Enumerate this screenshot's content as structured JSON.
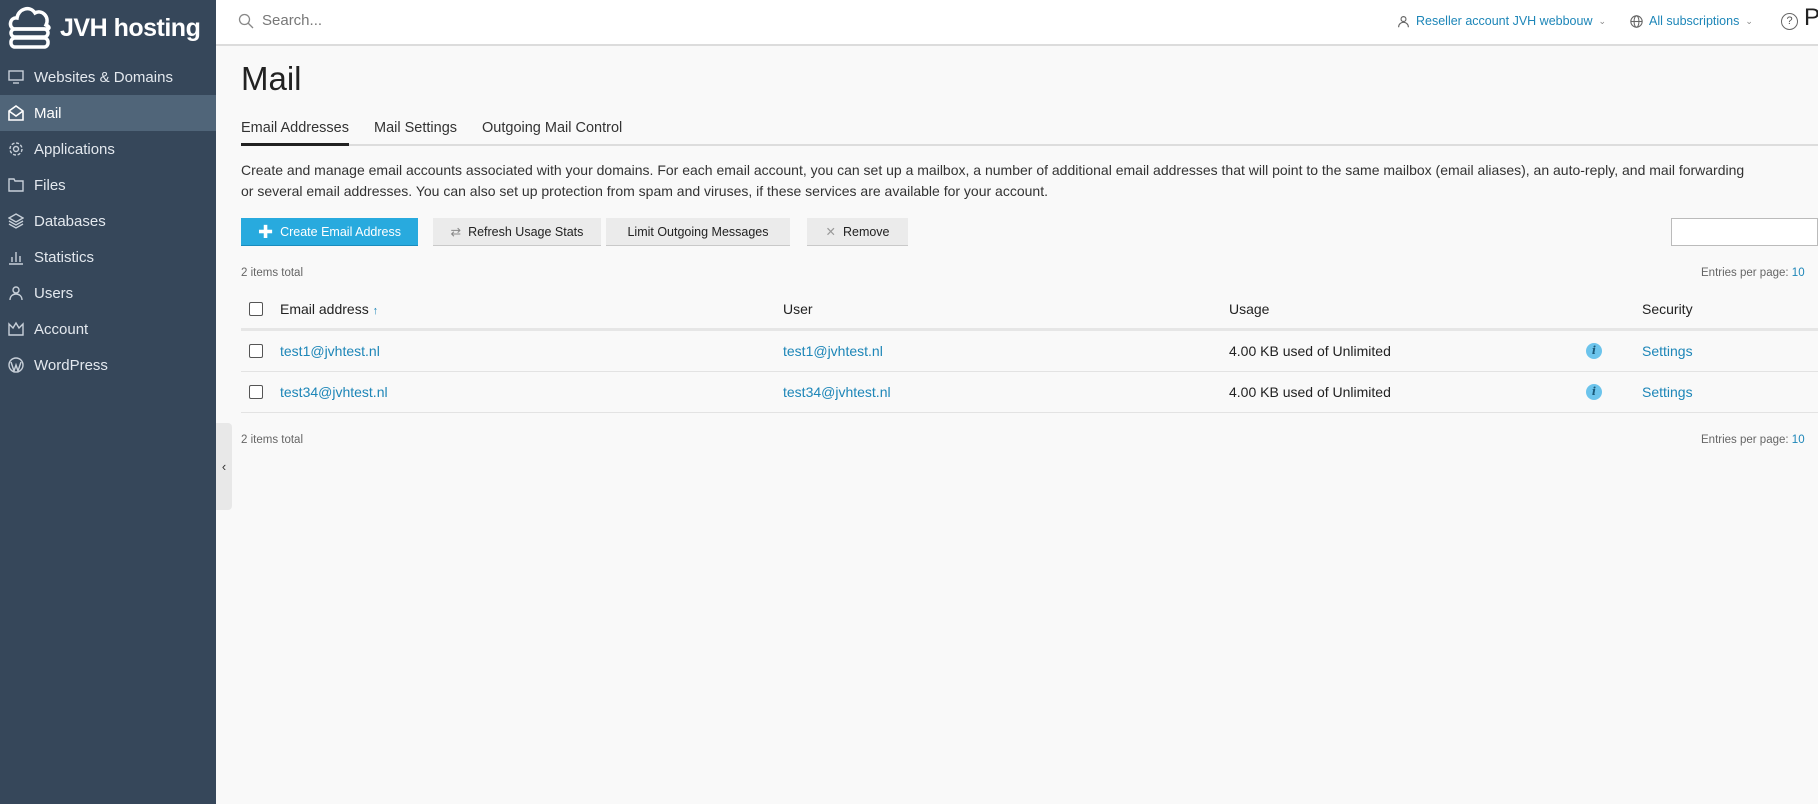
{
  "brand": {
    "name": "JVH hosting"
  },
  "sidebar": {
    "items": [
      {
        "label": "Websites & Domains",
        "icon": "monitor-icon"
      },
      {
        "label": "Mail",
        "icon": "mail-icon",
        "active": true
      },
      {
        "label": "Applications",
        "icon": "gear-icon"
      },
      {
        "label": "Files",
        "icon": "folder-icon"
      },
      {
        "label": "Databases",
        "icon": "layers-icon"
      },
      {
        "label": "Statistics",
        "icon": "bar-chart-icon"
      },
      {
        "label": "Users",
        "icon": "user-icon"
      },
      {
        "label": "Account",
        "icon": "account-icon"
      },
      {
        "label": "WordPress",
        "icon": "wordpress-icon"
      }
    ]
  },
  "topbar": {
    "search_placeholder": "Search...",
    "account": "Reseller account JVH webbouw",
    "subscriptions": "All subscriptions",
    "help": "?",
    "logo_letter": "P"
  },
  "page": {
    "title": "Mail",
    "tabs": [
      "Email Addresses",
      "Mail Settings",
      "Outgoing Mail Control"
    ],
    "description_1": "Create and manage email accounts associated with your domains. For each email account, you can set up a mailbox, a number of additional email addresses that will point to the same mailbox (email aliases), an auto-reply, and mail forwarding",
    "description_2": "or several email addresses. You can also set up protection from spam and viruses, if these services are available for your account."
  },
  "toolbar": {
    "create": "Create Email Address",
    "refresh": "Refresh Usage Stats",
    "limit": "Limit Outgoing Messages",
    "remove": "Remove",
    "search_value": ""
  },
  "list": {
    "total": "2 items total",
    "entries_label": "Entries per page:",
    "entries_value": "10",
    "columns": [
      "Email address",
      "User",
      "Usage",
      "Security"
    ],
    "sort_indicator": "↑",
    "rows": [
      {
        "email": "test1@jvhtest.nl",
        "user": "test1@jvhtest.nl",
        "usage": "4.00 KB used of Unlimited",
        "security": "Settings"
      },
      {
        "email": "test34@jvhtest.nl",
        "user": "test34@jvhtest.nl",
        "usage": "4.00 KB used of Unlimited",
        "security": "Settings"
      }
    ]
  },
  "colors": {
    "sidebar": "#36475a",
    "sidebar_active": "#506579",
    "accent": "#28aade",
    "link": "#1d86b8"
  }
}
